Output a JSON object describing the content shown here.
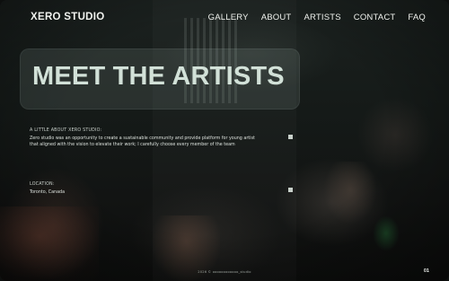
{
  "brand": {
    "name": "XERO STUDIO"
  },
  "nav": {
    "items": [
      {
        "label": "GALLERY"
      },
      {
        "label": "ABOUT"
      },
      {
        "label": "ARTISTS"
      },
      {
        "label": "CONTACT"
      },
      {
        "label": "FAQ"
      }
    ]
  },
  "hero": {
    "title": "MEET THE ARTISTS"
  },
  "about": {
    "label": "A LITTLE ABOUT XERO STUDIO:",
    "text": "Zero studio was an opportunity to create a sustainable community and provide platform for young artist that aligned with the vision to elevate their work; I carefully choose every member of the team"
  },
  "location": {
    "label": "LOCATION:",
    "value": "Toronto, Canada"
  },
  "footer": {
    "copyright": "2026 © oooooooooooo_studio"
  },
  "page": {
    "number": "01"
  }
}
